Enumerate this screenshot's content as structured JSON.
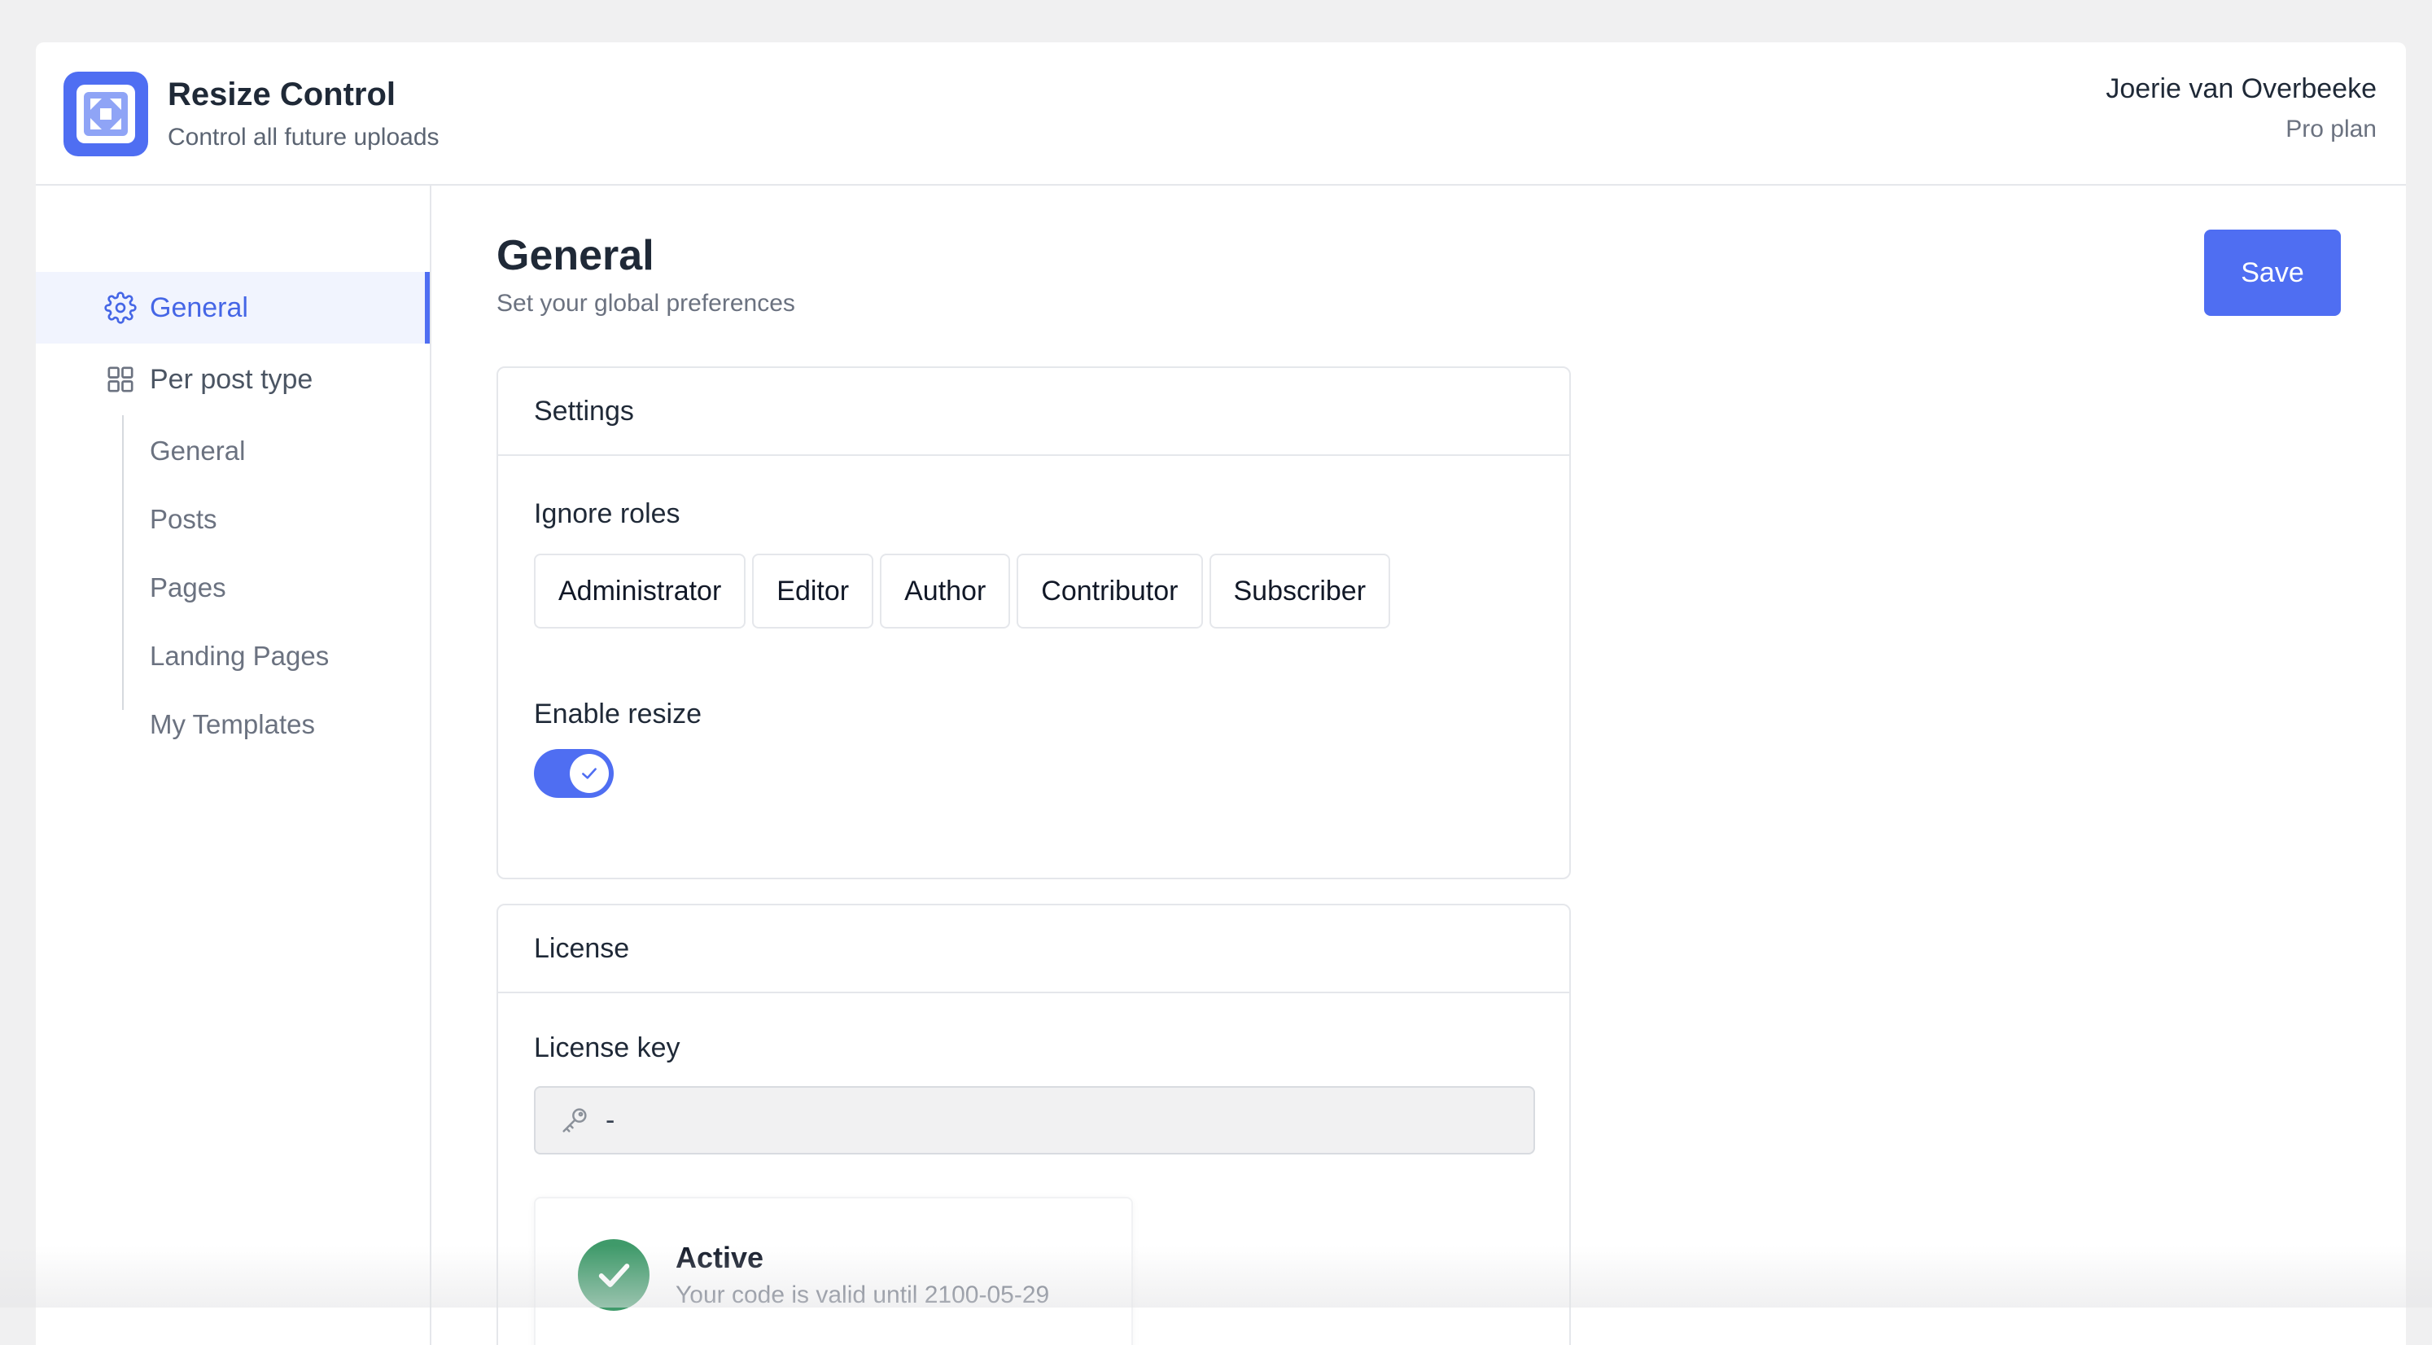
{
  "header": {
    "app_title": "Resize Control",
    "app_subtitle": "Control all future uploads",
    "user_name": "Joerie van Overbeeke",
    "user_plan": "Pro plan",
    "logo_icon": "resize-logo-icon"
  },
  "sidebar": {
    "items": [
      {
        "label": "General",
        "icon": "gear-icon",
        "active": true
      },
      {
        "label": "Per post type",
        "icon": "grid-icon",
        "active": false
      }
    ],
    "sub_items": [
      {
        "label": "General"
      },
      {
        "label": "Posts"
      },
      {
        "label": "Pages"
      },
      {
        "label": "Landing Pages"
      },
      {
        "label": "My Templates"
      }
    ]
  },
  "main": {
    "title": "General",
    "subtitle": "Set your global preferences",
    "save_label": "Save",
    "settings_card": {
      "title": "Settings",
      "ignore_roles_label": "Ignore roles",
      "roles": [
        "Administrator",
        "Editor",
        "Author",
        "Contributor",
        "Subscriber"
      ],
      "enable_resize_label": "Enable resize",
      "enable_resize_on": true
    },
    "license_card": {
      "title": "License",
      "license_key_label": "License key",
      "license_key_value": "-",
      "status_title": "Active",
      "status_text": "Your code is valid until 2100-05-29"
    }
  },
  "colors": {
    "accent": "#4f6ef2",
    "success": "#3f9a6a",
    "active_bg": "#f1f4fe"
  }
}
